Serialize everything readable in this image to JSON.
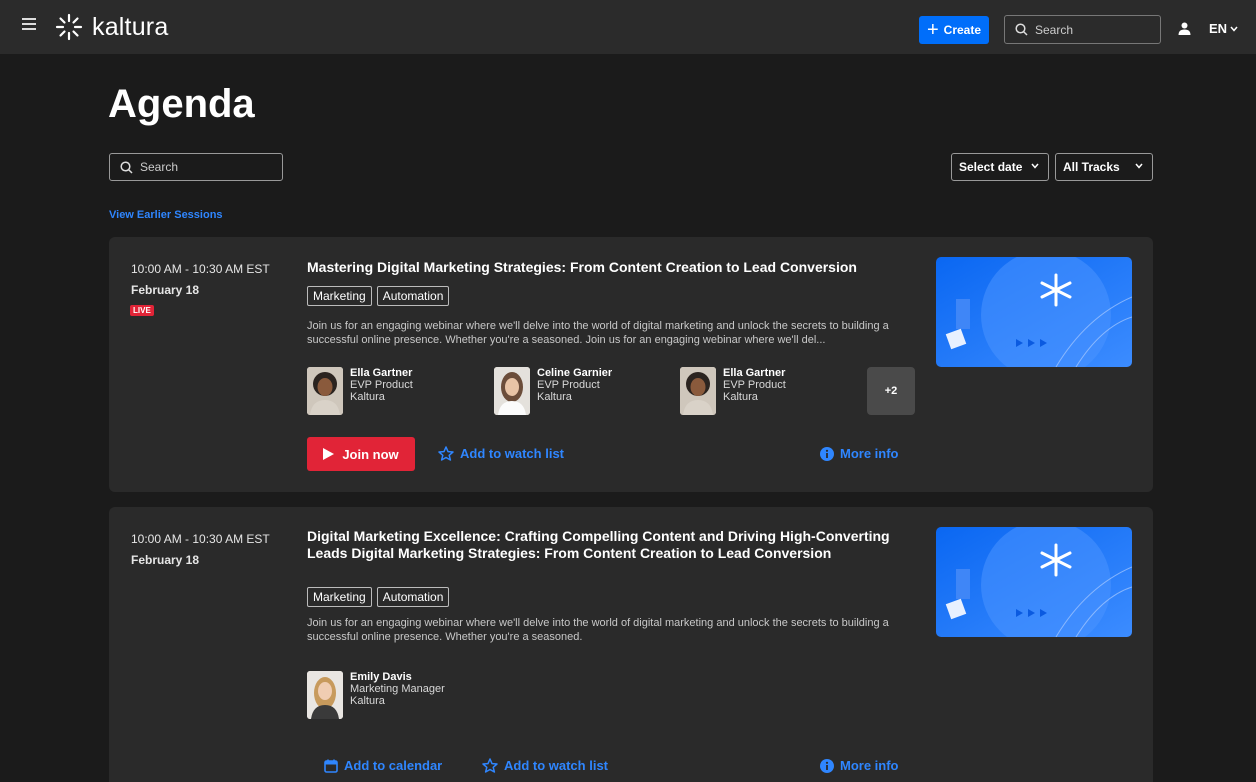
{
  "header": {
    "logo_text": "kaltura",
    "create_label": "Create",
    "search_placeholder": "Search",
    "language": "EN"
  },
  "page": {
    "title": "Agenda",
    "search_placeholder": "Search",
    "select_date_label": "Select date",
    "tracks_label": "All Tracks",
    "view_earlier_label": "View Earlier Sessions"
  },
  "sessions": [
    {
      "time": "10:00 AM - 10:30 AM EST",
      "date": "February 18",
      "live_badge": "LIVE",
      "title": "Mastering Digital Marketing Strategies: From Content Creation to Lead Conversion",
      "tags": [
        "Marketing",
        "Automation"
      ],
      "description": "Join us for an engaging webinar where we'll delve into the world of digital marketing and unlock the secrets to building a successful online presence. Whether you're a seasoned. Join us for an engaging webinar where we'll del...",
      "speakers": [
        {
          "name": "Ella Gartner",
          "role": "EVP Product",
          "company": "Kaltura"
        },
        {
          "name": "Celine Garnier",
          "role": "EVP Product",
          "company": "Kaltura"
        },
        {
          "name": "Ella Gartner",
          "role": "EVP Product",
          "company": "Kaltura"
        }
      ],
      "more_speakers": "+2",
      "join_label": "Join now",
      "watchlist_label": "Add to watch list",
      "more_info_label": "More info"
    },
    {
      "time": "10:00 AM - 10:30 AM EST",
      "date": "February 18",
      "title": "Digital Marketing Excellence: Crafting Compelling Content and Driving High-Converting Leads Digital Marketing Strategies: From Content Creation to Lead Conversion",
      "tags": [
        "Marketing",
        "Automation"
      ],
      "description": "Join us for an engaging webinar where we'll delve into the world of digital marketing and unlock the secrets to building a successful online presence. Whether you're a seasoned.",
      "speakers": [
        {
          "name": "Emily Davis",
          "role": "Marketing Manager",
          "company": "Kaltura"
        }
      ],
      "calendar_label": "Add to calendar",
      "watchlist_label": "Add to watch list",
      "more_info_label": "More info"
    }
  ],
  "colors": {
    "accent": "#006efa",
    "link": "#2f86ff",
    "live": "#e12437",
    "card": "#2a2a2a",
    "background": "#1b1b1b"
  },
  "icons": [
    "menu-icon",
    "kaltura-logo-icon",
    "plus-icon",
    "search-icon",
    "user-icon",
    "chevron-down-icon",
    "play-icon",
    "star-outline-icon",
    "info-icon",
    "calendar-icon"
  ]
}
